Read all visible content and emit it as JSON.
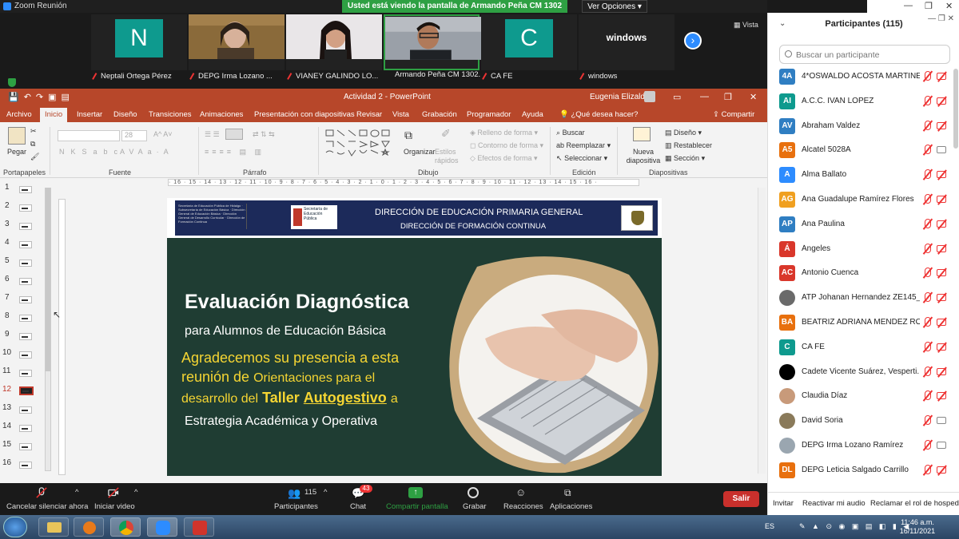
{
  "zoom": {
    "window_title": "Zoom Reunión",
    "share_banner": "Usted está viendo la pantalla de Armando Peña CM 1302 Apan",
    "view_options": "Ver Opciones",
    "layout_label": "Vista",
    "thumbnails": [
      {
        "type": "letter",
        "letter": "N",
        "name": "Neptali Ortega Pérez"
      },
      {
        "type": "photo",
        "name": "DEPG   Irma Lozano ..."
      },
      {
        "type": "photo",
        "name": "VIANEY GALINDO LO..."
      },
      {
        "type": "photo",
        "name": "Armando Peña CM 1302..."
      },
      {
        "type": "letter",
        "letter": "C",
        "name": "CA FE"
      },
      {
        "type": "text",
        "letter": "windows",
        "name": "windows"
      }
    ],
    "toolbar": {
      "unmute": "Cancelar silenciar ahora",
      "start_video": "Iniciar video",
      "participants": "Participantes",
      "participants_count": "115",
      "chat": "Chat",
      "chat_badge": "43",
      "share": "Compartir pantalla",
      "record": "Grabar",
      "reactions": "Reacciones",
      "apps": "Aplicaciones",
      "leave": "Salir"
    }
  },
  "powerpoint": {
    "doc_title": "Actividad 2  -  PowerPoint",
    "user": "Eugenia Elizalde",
    "tabs": [
      "Archivo",
      "Inicio",
      "Insertar",
      "Diseño",
      "Transiciones",
      "Animaciones",
      "Presentación con diapositivas",
      "Revisar",
      "Vista",
      "Grabación",
      "Programador",
      "Ayuda",
      "¿Qué desea hacer?",
      "Compartir"
    ],
    "active_tab": "Inicio",
    "ribbon": {
      "paste": "Pegar",
      "groups": [
        "Portapapeles",
        "Fuente",
        "Párrafo",
        "Dibujo",
        "Edición",
        "Diapositivas"
      ],
      "font_size": "28",
      "organize": "Organizar",
      "quick_styles": "Estilos rápidos",
      "fill": "Relleno de forma",
      "outline": "Contorno de forma",
      "effects": "Efectos de forma",
      "find": "Buscar",
      "replace": "Reemplazar",
      "select": "Seleccionar",
      "new_slide": "Nueva diapositiva",
      "layout": "Diseño",
      "reset": "Restablecer",
      "section": "Sección"
    },
    "ruler": "· 16 · 15 · 14 · 13 · 12 · 11 · 10 · 9 · 8 · 7 · 6 · 5 · 4 · 3 · 2 · 1 · 0 · 1 · 2 · 3 · 4 · 5 · 6 · 7 · 8 · 9 · 10 · 11 · 12 · 13 · 14 · 15 · 16 ·",
    "slide_numbers": [
      "1",
      "2",
      "3",
      "4",
      "5",
      "6",
      "7",
      "8",
      "9",
      "10",
      "11",
      "12",
      "13",
      "14",
      "15",
      "16"
    ],
    "active_slide": "12",
    "slide": {
      "header_small": "Secretaría de Educación Pública de Hidalgo · Subsecretaría de Educación Básica · Dirección General de Educación Básica · Dirección General de Desarrollo Curricular · Dirección de Formación Continua",
      "header_logo": "Secretaría de Educación Pública",
      "header_line1": "DIRECCIÓN DE EDUCACIÓN PRIMARIA GENERAL",
      "header_line2": "DIRECCIÓN DE FORMACIÓN CONTINUA",
      "title": "Evaluación Diagnóstica",
      "subtitle": "para Alumnos de Educación Básica",
      "msg_a": "Agradecemos su presencia a esta",
      "msg_b": "reunión de",
      "msg_c": "Orientaciones para el",
      "msg_d": "desarrollo del",
      "msg_e": "Taller",
      "msg_f": "Autogestivo",
      "msg_g": "a",
      "footer": "Estrategia Académica y Operativa"
    }
  },
  "participants_panel": {
    "title": "Participantes (115)",
    "search_placeholder": "Buscar un participante",
    "people": [
      {
        "initials": "4A",
        "color": "#2f7ec2",
        "name": "4*OSWALDO ACOSTA MARTINEZ",
        "cam": "off"
      },
      {
        "initials": "AI",
        "color": "#0e9a8e",
        "name": "A.C.C. IVAN LOPEZ",
        "cam": "off"
      },
      {
        "initials": "AV",
        "color": "#2f7ec2",
        "name": "Abraham  Valdez",
        "cam": "off"
      },
      {
        "initials": "A5",
        "color": "#e8700e",
        "name": "Alcatel 5028A",
        "cam": "on"
      },
      {
        "initials": "A",
        "color": "#2d8cff",
        "name": "Alma Ballato",
        "cam": "off"
      },
      {
        "initials": "AG",
        "color": "#f0a020",
        "name": "Ana Guadalupe Ramírez Flores",
        "cam": "off"
      },
      {
        "initials": "AP",
        "color": "#2f7ec2",
        "name": "Ana Paulina",
        "cam": "off"
      },
      {
        "initials": "Á",
        "color": "#d9372b",
        "name": "Ángeles",
        "cam": "off"
      },
      {
        "initials": "AC",
        "color": "#d9372b",
        "name": "Antonio Cuenca",
        "cam": "off"
      },
      {
        "initials": "",
        "color": "#6a6a6a",
        "name": "ATP Johanan Hernandez ZE145_...",
        "cam": "off"
      },
      {
        "initials": "BA",
        "color": "#e8700e",
        "name": "BEATRIZ ADRIANA MENDEZ RO...",
        "cam": "off"
      },
      {
        "initials": "C",
        "color": "#0e9a8e",
        "name": "CA FE",
        "cam": "off"
      },
      {
        "initials": "",
        "color": "#000000",
        "name": "Cadete Vicente Suárez, Vesperti...",
        "cam": "off"
      },
      {
        "initials": "",
        "color": "#c89a7a",
        "name": "Claudia Díaz",
        "cam": "off"
      },
      {
        "initials": "",
        "color": "#8a7a5a",
        "name": "David Soria",
        "cam": "on"
      },
      {
        "initials": "",
        "color": "#9aa6b0",
        "name": "DEPG   Irma Lozano Ramírez",
        "cam": "on"
      },
      {
        "initials": "DL",
        "color": "#e8700e",
        "name": "DEPG Leticia Salgado Carrillo",
        "cam": "off"
      }
    ],
    "footer": {
      "invite": "Invitar",
      "unmute_all": "Reactivar mi audio",
      "reclaim": "Reclamar el rol de hospedador"
    }
  },
  "taskbar": {
    "language": "ES",
    "time": "11:46 a.m.",
    "date": "16/11/2021"
  }
}
